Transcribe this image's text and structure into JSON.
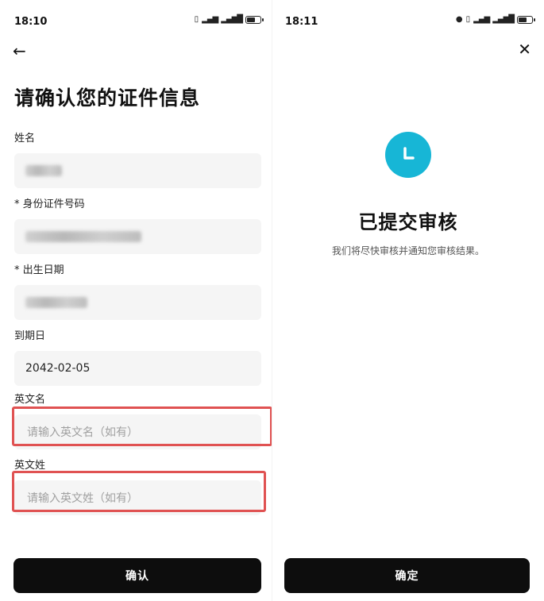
{
  "left": {
    "status": {
      "time": "18:10"
    },
    "title": "请确认您的证件信息",
    "fields": [
      {
        "label": "姓名",
        "value": ""
      },
      {
        "label": "* 身份证件号码",
        "value": ""
      },
      {
        "label": "* 出生日期",
        "value": ""
      },
      {
        "label": "到期日",
        "value": "2042-02-05"
      },
      {
        "label": "英文名",
        "placeholder": "请输入英文名（如有）"
      },
      {
        "label": "英文姓",
        "placeholder": "请输入英文姓（如有）"
      }
    ],
    "confirm_label": "确认"
  },
  "right": {
    "status": {
      "time": "18:11"
    },
    "title": "已提交审核",
    "description": "我们将尽快审核并通知您审核结果。",
    "confirm_label": "确定"
  },
  "colors": {
    "accent": "#17b6d6",
    "highlight": "#e05252",
    "button": "#0d0d0d"
  }
}
